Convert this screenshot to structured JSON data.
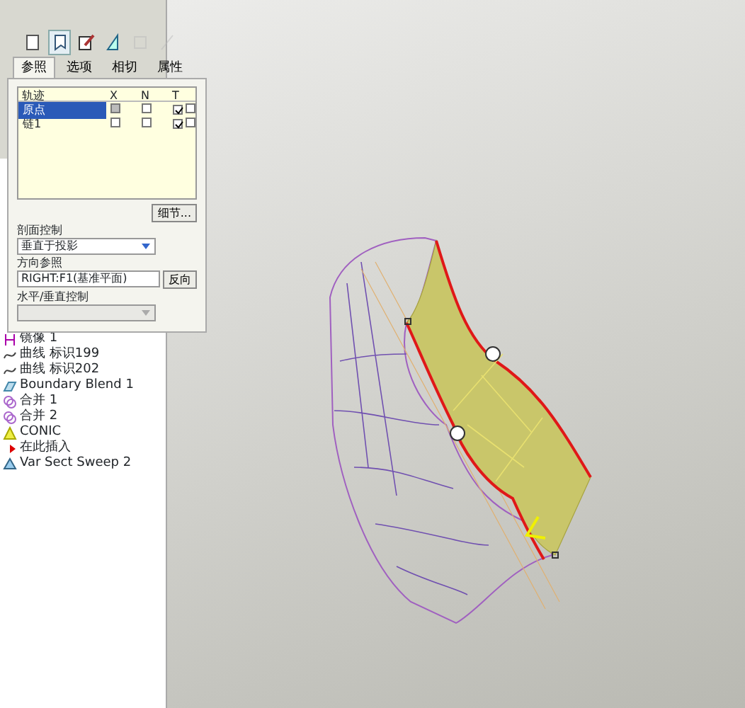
{
  "toolbar": [
    {
      "kind": "surface",
      "selected": false,
      "disabled": false
    },
    {
      "kind": "solid",
      "selected": true,
      "disabled": false
    },
    {
      "kind": "edit",
      "selected": false,
      "disabled": false
    },
    {
      "kind": "sketch",
      "selected": false,
      "disabled": false
    },
    {
      "kind": "rect",
      "selected": false,
      "disabled": true
    },
    {
      "kind": "line",
      "selected": false,
      "disabled": true
    }
  ],
  "tabs": [
    {
      "label": "参照",
      "selected": true
    },
    {
      "label": "选项",
      "selected": false
    },
    {
      "label": "相切",
      "selected": false
    },
    {
      "label": "属性",
      "selected": false
    }
  ],
  "trajectory_table": {
    "columns": [
      "轨迹",
      "X",
      "N",
      "T"
    ],
    "rows": [
      {
        "name": "原点",
        "selected": true,
        "x": {
          "checked": false,
          "disabled": true
        },
        "n": {
          "checked": false
        },
        "t": {
          "checked": true
        },
        "t2": {
          "checked": false
        }
      },
      {
        "name": "链1",
        "selected": false,
        "x": {
          "checked": false,
          "disabled": false
        },
        "n": {
          "checked": false
        },
        "t": {
          "checked": true
        },
        "t2": {
          "checked": false
        }
      }
    ]
  },
  "details_button": "细节...",
  "section_control": {
    "label": "剖面控制",
    "value": "垂直于投影"
  },
  "direction_reference": {
    "label": "方向参照",
    "value": "RIGHT:F1(基准平面)",
    "button": "反向"
  },
  "horizontal_vertical_control": {
    "label": "水平/垂直控制",
    "disabled": true
  },
  "model_tree": {
    "items": [
      {
        "kind": "mirror",
        "label": "镜像 1"
      },
      {
        "kind": "curve",
        "label": "曲线 标识199"
      },
      {
        "kind": "curve",
        "label": "曲线 标识202"
      },
      {
        "kind": "blend",
        "label": "Boundary Blend 1"
      },
      {
        "kind": "merge",
        "label": "合并 1"
      },
      {
        "kind": "merge",
        "label": "合并 2"
      },
      {
        "kind": "conic",
        "label": "CONIC"
      },
      {
        "kind": "insert",
        "label": "在此插入"
      },
      {
        "kind": "sweep",
        "label": "Var Sect Sweep 2"
      }
    ]
  }
}
